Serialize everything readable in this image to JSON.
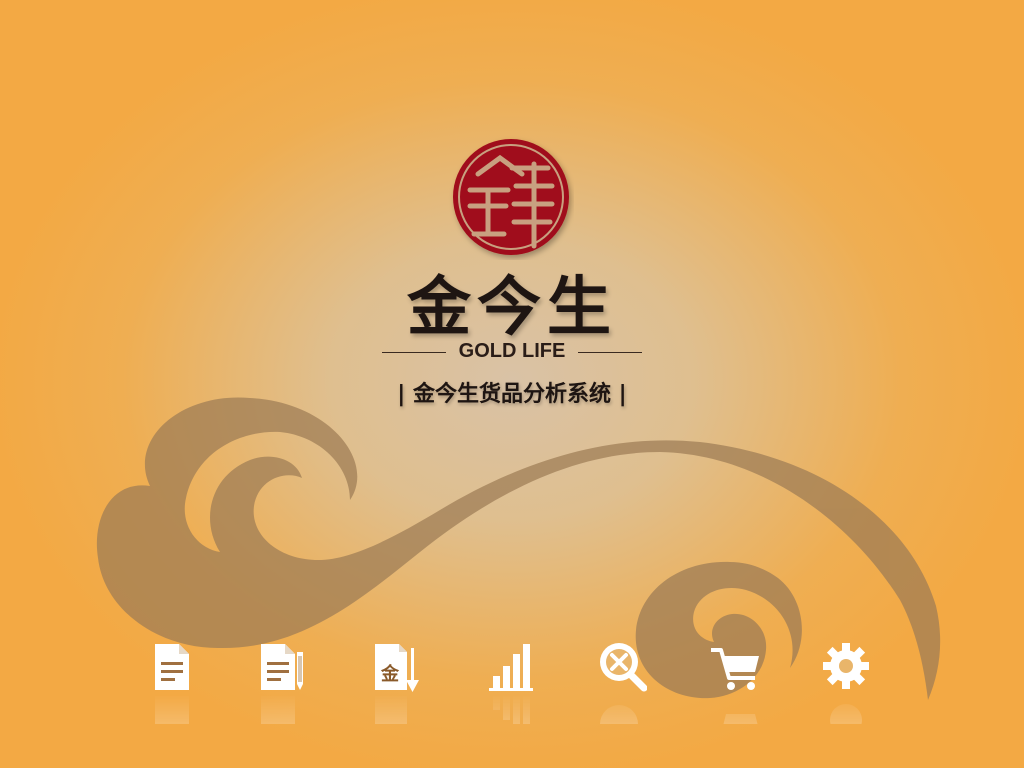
{
  "app": {
    "brand_cn": "金今生",
    "brand_en": "GOLD LIFE",
    "subtitle": "| 金今生货品分析系统 |",
    "seal_text": "金今生"
  },
  "colors": {
    "background_center": "#d9c2a6",
    "background_edge": "#f3a944",
    "seal_red": "#a0101a",
    "swirl": "#9c7b55",
    "icon_white": "#ffffff"
  },
  "toolbar": {
    "items": [
      {
        "icon": "document-icon"
      },
      {
        "icon": "edit-document-icon"
      },
      {
        "icon": "gold-document-icon",
        "glyph": "金"
      },
      {
        "icon": "bar-chart-icon"
      },
      {
        "icon": "search-cancel-icon"
      },
      {
        "icon": "shopping-cart-icon"
      },
      {
        "icon": "gear-icon"
      }
    ]
  }
}
